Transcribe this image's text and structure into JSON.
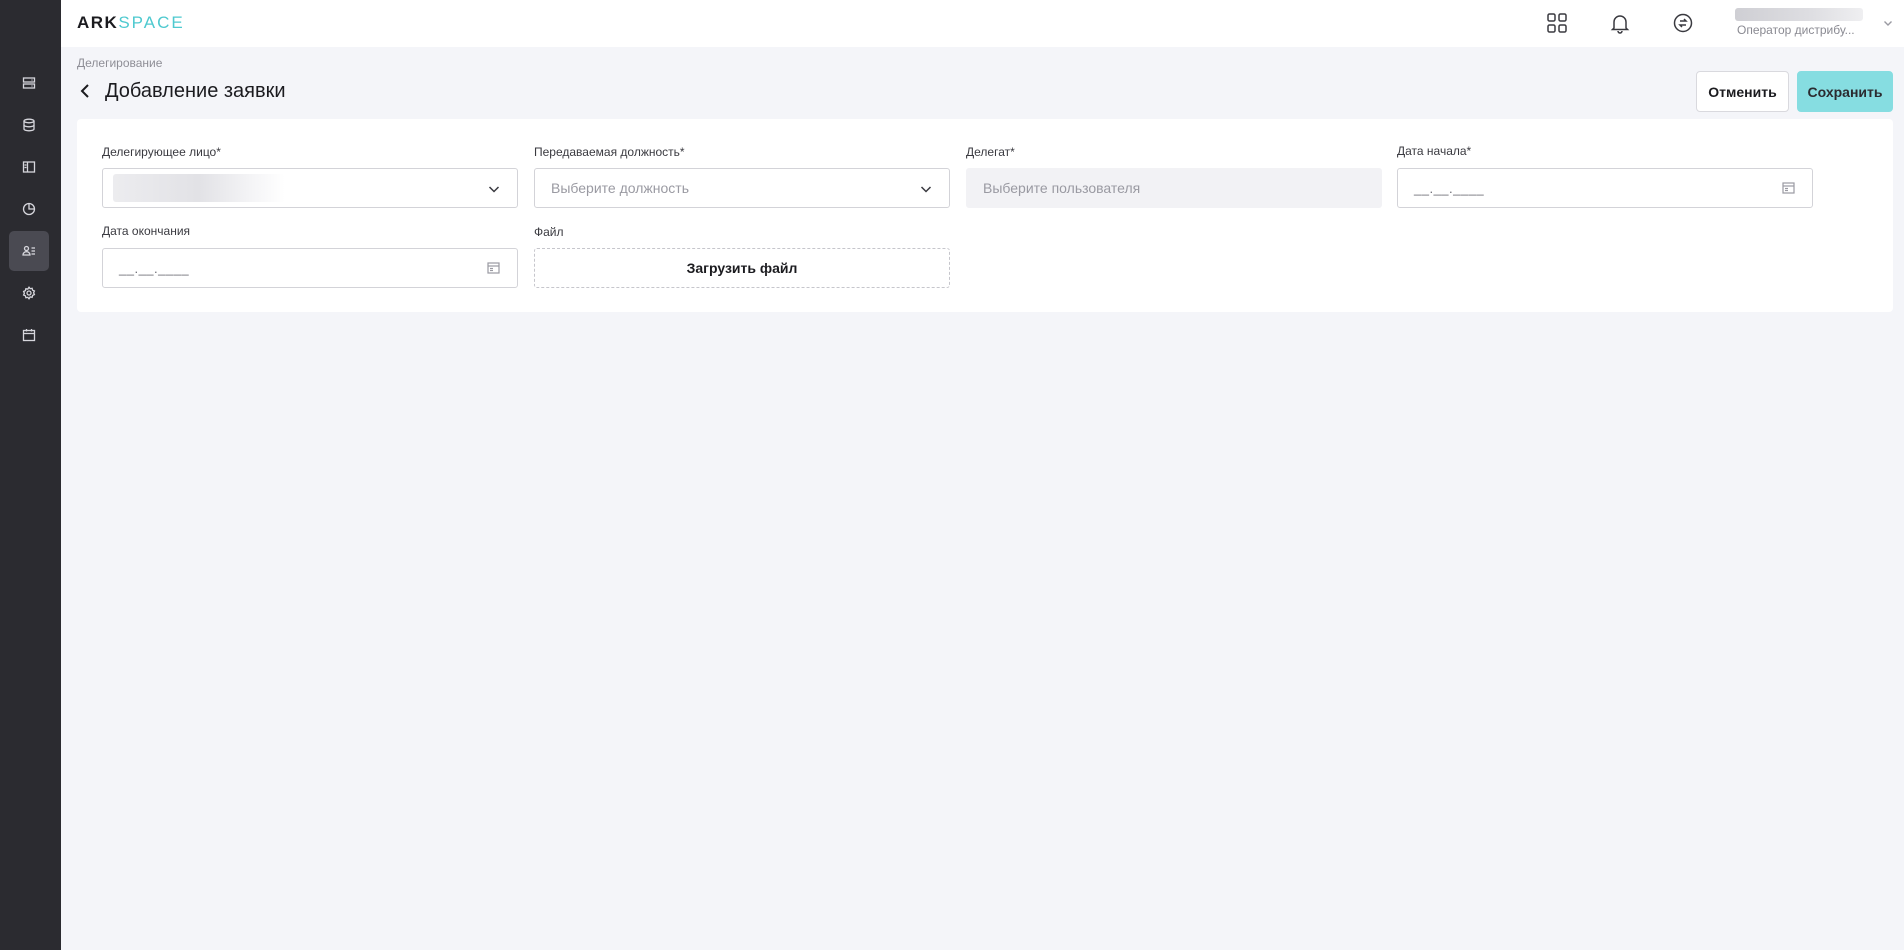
{
  "brand": {
    "part1": "ARK",
    "part2": "SPACE"
  },
  "sidebar": {
    "items": [
      {
        "icon": "server-icon"
      },
      {
        "icon": "database-icon"
      },
      {
        "icon": "layout-icon"
      },
      {
        "icon": "pie-chart-icon"
      },
      {
        "icon": "users-icon",
        "active": true
      },
      {
        "icon": "gear-icon"
      },
      {
        "icon": "calendar-icon"
      }
    ]
  },
  "header": {
    "icons": [
      "apps-grid-icon",
      "bell-icon",
      "swap-icon"
    ],
    "user": {
      "role": "Оператор дистрибу..."
    }
  },
  "page": {
    "breadcrumb": "Делегирование",
    "title": "Добавление заявки",
    "cancel_label": "Отменить",
    "save_label": "Сохранить"
  },
  "form": {
    "delegating_person": {
      "label": "Делегирующее лицо*"
    },
    "position": {
      "label": "Передаваемая должность*",
      "placeholder": "Выберите должность"
    },
    "delegate": {
      "label": "Делегат*",
      "placeholder": "Выберите пользователя"
    },
    "start_date": {
      "label": "Дата начала*",
      "mask": "__.__.____"
    },
    "end_date": {
      "label": "Дата окончания",
      "mask": "__.__.____"
    },
    "file": {
      "label": "Файл",
      "button": "Загрузить файл"
    }
  },
  "colors": {
    "accent": "#4ec9cf",
    "save_button": "#86dde1",
    "sidebar": "#2b2b30",
    "background": "#f4f5f9"
  }
}
